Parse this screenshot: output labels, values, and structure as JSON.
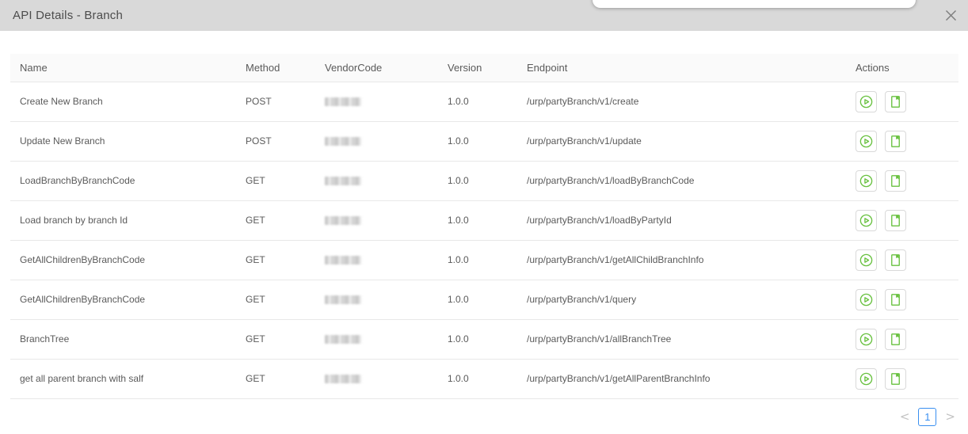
{
  "modal": {
    "title": "API Details - Branch"
  },
  "table": {
    "columns": {
      "name": "Name",
      "method": "Method",
      "vendor_code": "VendorCode",
      "version": "Version",
      "endpoint": "Endpoint",
      "actions": "Actions"
    },
    "rows": [
      {
        "name": "Create New Branch",
        "method": "POST",
        "vendor_code_redacted": true,
        "version": "1.0.0",
        "endpoint": "/urp/partyBranch/v1/create"
      },
      {
        "name": "Update New Branch",
        "method": "POST",
        "vendor_code_redacted": true,
        "version": "1.0.0",
        "endpoint": "/urp/partyBranch/v1/update"
      },
      {
        "name": "LoadBranchByBranchCode",
        "method": "GET",
        "vendor_code_redacted": true,
        "version": "1.0.0",
        "endpoint": "/urp/partyBranch/v1/loadByBranchCode"
      },
      {
        "name": "Load branch by branch Id",
        "method": "GET",
        "vendor_code_redacted": true,
        "version": "1.0.0",
        "endpoint": "/urp/partyBranch/v1/loadByPartyId"
      },
      {
        "name": "GetAllChildrenByBranchCode",
        "method": "GET",
        "vendor_code_redacted": true,
        "version": "1.0.0",
        "endpoint": "/urp/partyBranch/v1/getAllChildBranchInfo"
      },
      {
        "name": "GetAllChildrenByBranchCode",
        "method": "GET",
        "vendor_code_redacted": true,
        "version": "1.0.0",
        "endpoint": "/urp/partyBranch/v1/query"
      },
      {
        "name": "BranchTree",
        "method": "GET",
        "vendor_code_redacted": true,
        "version": "1.0.0",
        "endpoint": "/urp/partyBranch/v1/allBranchTree"
      },
      {
        "name": "get all parent branch with salf",
        "method": "GET",
        "vendor_code_redacted": true,
        "version": "1.0.0",
        "endpoint": "/urp/partyBranch/v1/getAllParentBranchInfo"
      }
    ],
    "row_action_icons": [
      "run-api-icon",
      "api-doc-icon"
    ]
  },
  "pagination": {
    "prev": "<",
    "page": "1",
    "next": ">"
  },
  "colors": {
    "accent_green": "#68c13f",
    "accent_blue": "#3a8ff0",
    "header_gray": "#d9d9d9"
  }
}
